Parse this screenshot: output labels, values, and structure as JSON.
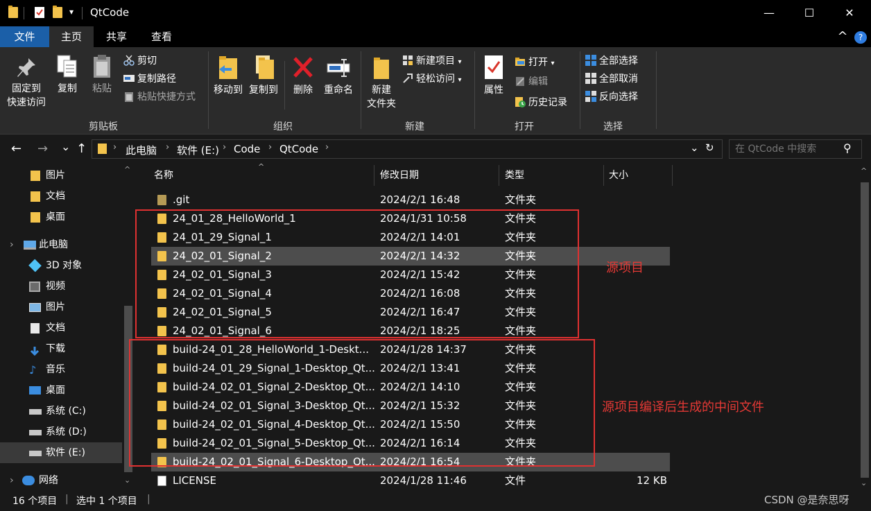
{
  "window": {
    "title": "QtCode",
    "minimize_glyph": "—",
    "maximize_glyph": "☐",
    "close_glyph": "✕",
    "qa_dropdown_glyph": "▾"
  },
  "ribbon_tabs": [
    {
      "label": "文件"
    },
    {
      "label": "主页"
    },
    {
      "label": "共享"
    },
    {
      "label": "查看"
    }
  ],
  "ribbon_controls": {
    "collapse_glyph": "^",
    "help_glyph": "?"
  },
  "ribbon": {
    "clipboard": {
      "label": "剪贴板",
      "pin_line1": "固定到",
      "pin_line2": "快速访问",
      "copy": "复制",
      "paste": "粘贴",
      "cut": "剪切",
      "copy_path": "复制路径",
      "paste_shortcut": "粘贴快捷方式"
    },
    "organize": {
      "label": "组织",
      "move_to": "移动到",
      "copy_to": "复制到",
      "delete": "删除",
      "rename": "重命名"
    },
    "new": {
      "label": "新建",
      "new_folder_line1": "新建",
      "new_folder_line2": "文件夹",
      "new_item": "新建项目",
      "easy_access": "轻松访问"
    },
    "open": {
      "label": "打开",
      "properties": "属性",
      "open": "打开",
      "edit": "编辑",
      "history": "历史记录"
    },
    "select": {
      "label": "选择",
      "select_all": "全部选择",
      "select_none": "全部取消",
      "invert_selection": "反向选择"
    }
  },
  "address": {
    "back_glyph": "←",
    "forward_glyph": "→",
    "recent_glyph": "⌄",
    "up_glyph": "↑",
    "crumbs": [
      "此电脑",
      "软件 (E:)",
      "Code",
      "QtCode"
    ],
    "separator": "›",
    "dropdown_glyph": "⌄",
    "refresh_glyph": "↻",
    "search_placeholder": "在 QtCode 中搜索",
    "search_glyph": "⚲"
  },
  "nav_pane": {
    "items": [
      {
        "label": "图片",
        "icon": "folder-icon"
      },
      {
        "label": "文档",
        "icon": "folder-icon"
      },
      {
        "label": "桌面",
        "icon": "folder-icon"
      },
      {
        "label": "此电脑",
        "icon": "computer-icon"
      },
      {
        "label": "3D 对象",
        "icon": "cube-icon"
      },
      {
        "label": "视频",
        "icon": "video-icon"
      },
      {
        "label": "图片",
        "icon": "picture-icon"
      },
      {
        "label": "文档",
        "icon": "document-icon"
      },
      {
        "label": "下载",
        "icon": "download-icon"
      },
      {
        "label": "音乐",
        "icon": "music-icon"
      },
      {
        "label": "桌面",
        "icon": "desktop-icon"
      },
      {
        "label": "系统 (C:)",
        "icon": "drive-icon"
      },
      {
        "label": "系统 (D:)",
        "icon": "drive-icon"
      },
      {
        "label": "软件 (E:)",
        "icon": "drive-icon",
        "selected": true
      },
      {
        "label": "网络",
        "icon": "network-icon"
      }
    ],
    "expand_glyph": "›",
    "scroll_up_glyph": "^",
    "scroll_down_glyph": "⌄"
  },
  "file_list": {
    "sort_glyph": "^",
    "columns": [
      "名称",
      "修改日期",
      "类型",
      "大小"
    ],
    "rows": [
      {
        "name": ".git",
        "date": "2024/2/1 16:48",
        "type": "文件夹",
        "size": "",
        "icon": "folder-icon"
      },
      {
        "name": "24_01_28_HelloWorld_1",
        "date": "2024/1/31 10:58",
        "type": "文件夹",
        "size": "",
        "icon": "folder-icon"
      },
      {
        "name": "24_01_29_Signal_1",
        "date": "2024/2/1 14:01",
        "type": "文件夹",
        "size": "",
        "icon": "folder-icon"
      },
      {
        "name": "24_02_01_Signal_2",
        "date": "2024/2/1 14:32",
        "type": "文件夹",
        "size": "",
        "icon": "folder-icon",
        "selected": true
      },
      {
        "name": "24_02_01_Signal_3",
        "date": "2024/2/1 15:42",
        "type": "文件夹",
        "size": "",
        "icon": "folder-icon"
      },
      {
        "name": "24_02_01_Signal_4",
        "date": "2024/2/1 16:08",
        "type": "文件夹",
        "size": "",
        "icon": "folder-icon"
      },
      {
        "name": "24_02_01_Signal_5",
        "date": "2024/2/1 16:47",
        "type": "文件夹",
        "size": "",
        "icon": "folder-icon"
      },
      {
        "name": "24_02_01_Signal_6",
        "date": "2024/2/1 18:25",
        "type": "文件夹",
        "size": "",
        "icon": "folder-icon"
      },
      {
        "name": "build-24_01_28_HelloWorld_1-Deskt...",
        "date": "2024/1/28 14:37",
        "type": "文件夹",
        "size": "",
        "icon": "folder-icon"
      },
      {
        "name": "build-24_01_29_Signal_1-Desktop_Qt...",
        "date": "2024/2/1 13:41",
        "type": "文件夹",
        "size": "",
        "icon": "folder-icon"
      },
      {
        "name": "build-24_02_01_Signal_2-Desktop_Qt...",
        "date": "2024/2/1 14:10",
        "type": "文件夹",
        "size": "",
        "icon": "folder-icon"
      },
      {
        "name": "build-24_02_01_Signal_3-Desktop_Qt...",
        "date": "2024/2/1 15:32",
        "type": "文件夹",
        "size": "",
        "icon": "folder-icon"
      },
      {
        "name": "build-24_02_01_Signal_4-Desktop_Qt...",
        "date": "2024/2/1 15:50",
        "type": "文件夹",
        "size": "",
        "icon": "folder-icon"
      },
      {
        "name": "build-24_02_01_Signal_5-Desktop_Qt...",
        "date": "2024/2/1 16:14",
        "type": "文件夹",
        "size": "",
        "icon": "folder-icon"
      },
      {
        "name": "build-24_02_01_Signal_6-Desktop_Qt...",
        "date": "2024/2/1 16:54",
        "type": "文件夹",
        "size": "",
        "icon": "folder-icon",
        "hovered": true
      },
      {
        "name": "LICENSE",
        "date": "2024/1/28 11:46",
        "type": "文件",
        "size": "12 KB",
        "icon": "file-icon"
      }
    ],
    "scroll_up_glyph": "^",
    "scroll_down_glyph": "⌄"
  },
  "annotations": {
    "source_label": "源项目",
    "build_label": "源项目编译后生成的中间文件",
    "color": "#e03131"
  },
  "status_bar": {
    "item_count": "16 个项目",
    "selected_count": "选中 1 个项目",
    "separator": "|",
    "watermark": "CSDN @是奈思呀"
  },
  "colors": {
    "background": "#191919",
    "ribbon": "#2b2b2b",
    "file_tab": "#1b5fa8",
    "folder": "#f3c34c",
    "selection": "#4d4d4d"
  }
}
